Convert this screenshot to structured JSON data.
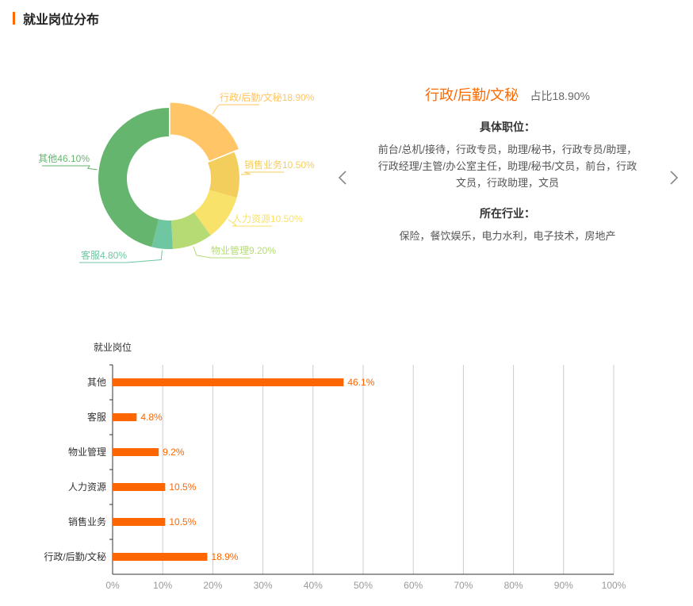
{
  "header": {
    "title": "就业岗位分布"
  },
  "detail": {
    "name": "行政/后勤/文秘",
    "share": "占比18.90%",
    "positions_title": "具体职位：",
    "positions_lines": [
      "前台/总机/接待，行政专员，助理/秘书，行政专员/助理，",
      "行政经理/主管/办公室主任，助理/秘书/文员，前台，行政",
      "文员，行政助理，文员"
    ],
    "industries_title": "所在行业：",
    "industries": "保险，餐饮娱乐，电力水利，电子技术，房地产"
  },
  "chart_data": [
    {
      "type": "pie",
      "variant": "donut",
      "categories": [
        "行政/后勤/文秘",
        "销售业务",
        "人力资源",
        "物业管理",
        "客服",
        "其他"
      ],
      "values": [
        18.9,
        10.5,
        10.5,
        9.2,
        4.8,
        46.1
      ],
      "labels": [
        "行政/后勤/文秘18.90%",
        "销售业务10.50%",
        "人力资源10.50%",
        "物业管理9.20%",
        "客服4.80%",
        "其他46.10%"
      ],
      "colors": [
        "#ffc566",
        "#f4ce5c",
        "#f8e26a",
        "#b6db74",
        "#6fc7a1",
        "#66b56e"
      ],
      "highlighted": "行政/后勤/文秘"
    },
    {
      "type": "bar",
      "orientation": "horizontal",
      "ylabel": "就业岗位",
      "categories": [
        "其他",
        "客服",
        "物业管理",
        "人力资源",
        "销售业务",
        "行政/后勤/文秘"
      ],
      "values": [
        46.1,
        4.8,
        9.2,
        10.5,
        10.5,
        18.9
      ],
      "value_labels": [
        "46.1%",
        "4.8%",
        "9.2%",
        "10.5%",
        "10.5%",
        "18.9%"
      ],
      "x_ticks": [
        "0%",
        "10%",
        "20%",
        "30%",
        "40%",
        "50%",
        "60%",
        "70%",
        "80%",
        "90%",
        "100%"
      ],
      "xlim": [
        0,
        100
      ],
      "grid": true,
      "bar_color": "#ff6600"
    }
  ]
}
